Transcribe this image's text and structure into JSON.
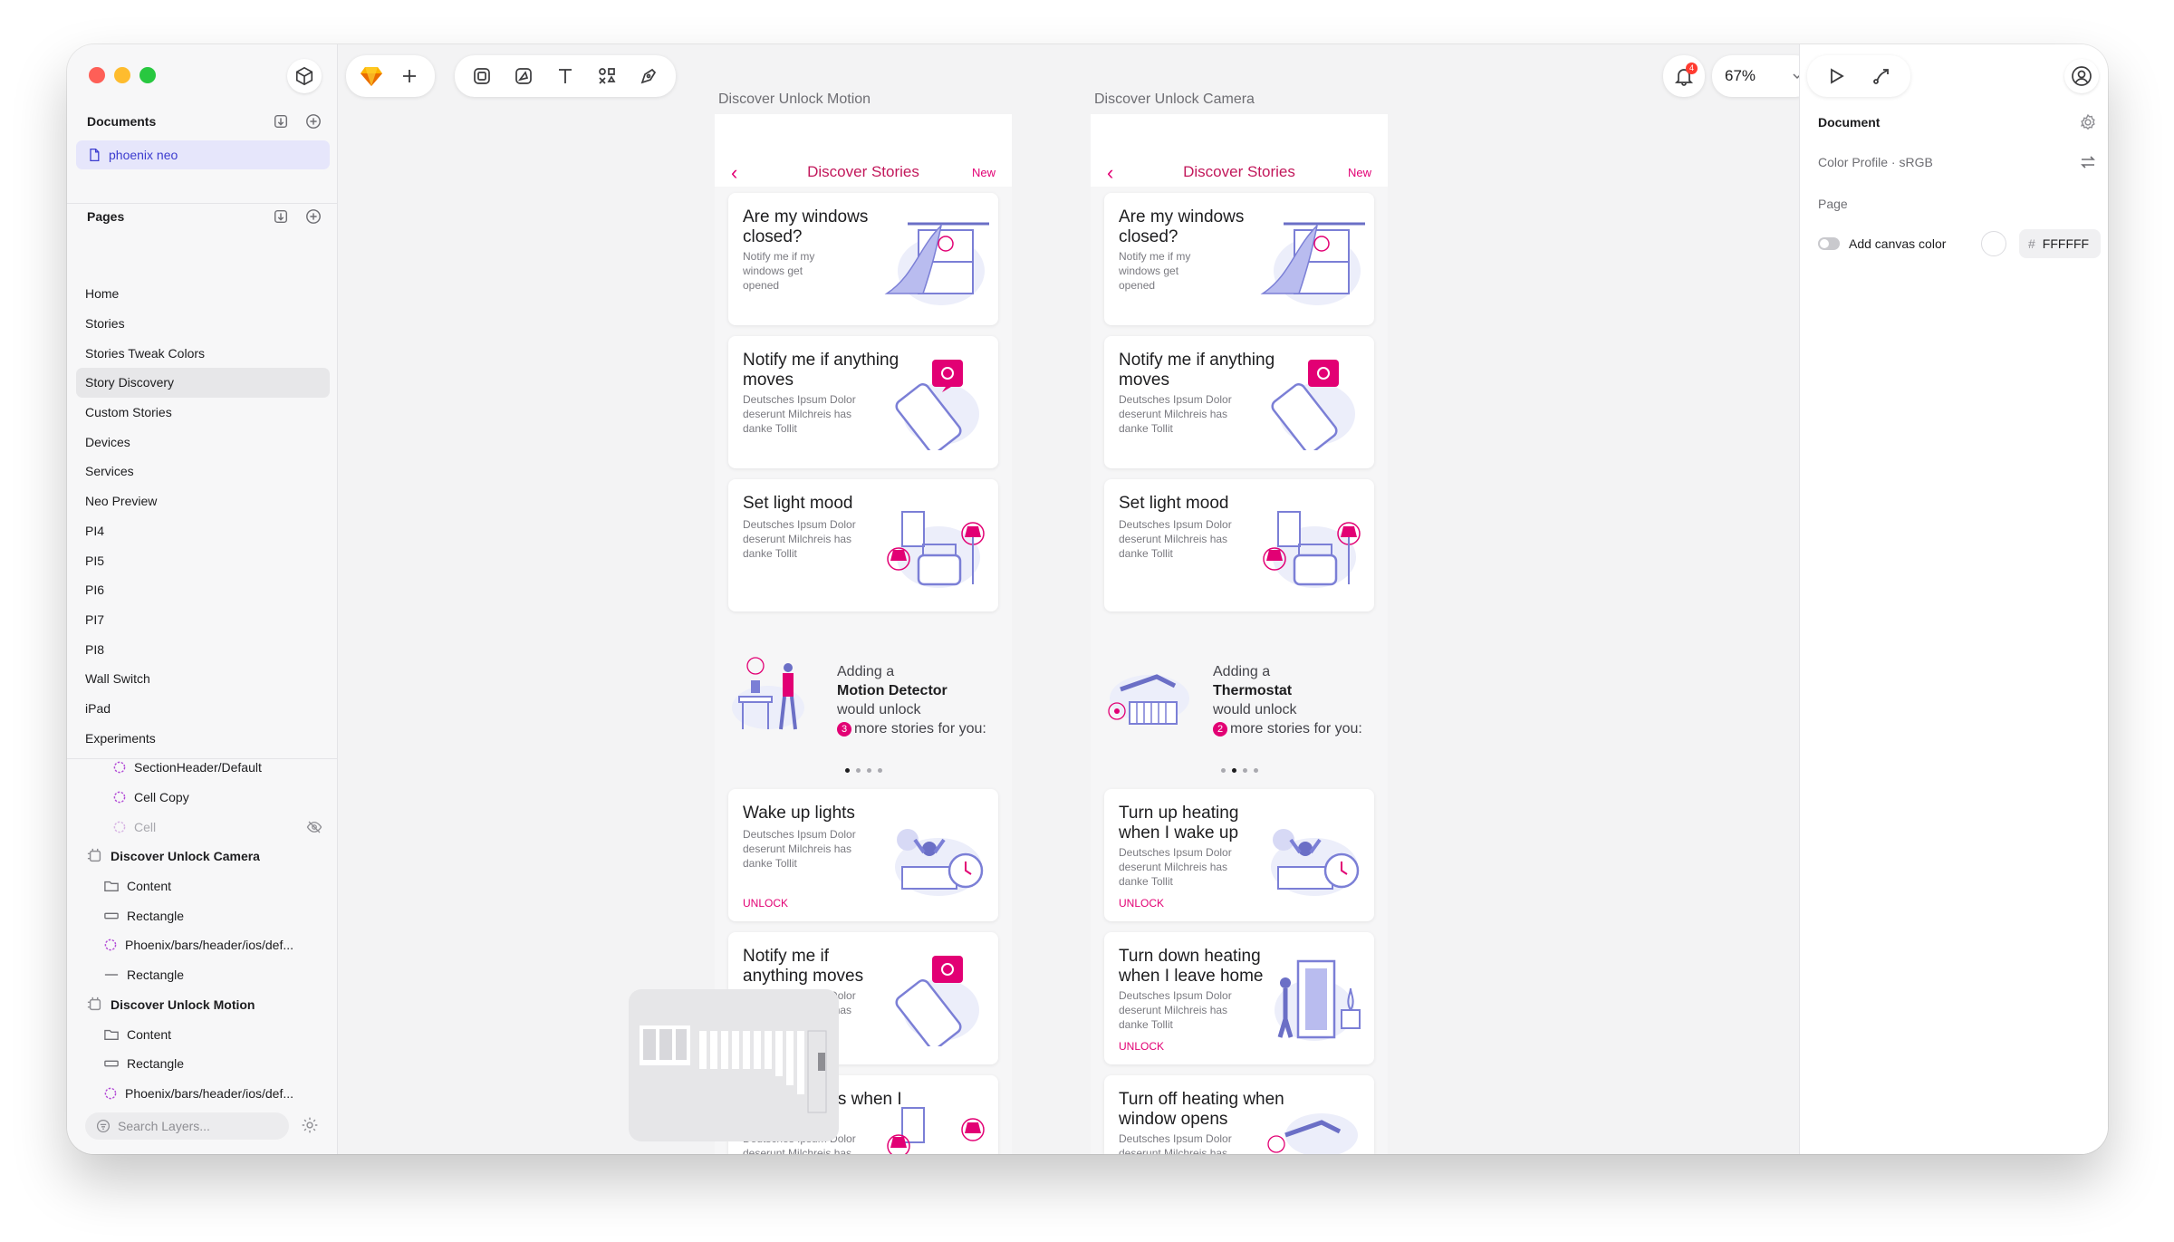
{
  "sidebar": {
    "documents_title": "Documents",
    "document_item": "phoenix neo",
    "pages_title": "Pages",
    "pages": [
      "Home",
      "Stories",
      "Stories Tweak Colors",
      "Story Discovery",
      "Custom Stories",
      "Devices",
      "Services",
      "Neo Preview",
      "PI4",
      "PI5",
      "PI6",
      "PI7",
      "PI8",
      "Wall Switch",
      "iPad",
      "Experiments"
    ],
    "active_page": "Story Discovery",
    "layers": {
      "section_header": "SectionHeader/Default",
      "cell_copy": "Cell Copy",
      "cell": "Cell",
      "artboard_camera": "Discover Unlock Camera",
      "artboard_motion": "Discover Unlock Motion",
      "content": "Content",
      "rectangle": "Rectangle",
      "phoenix_header": "Phoenix/bars/header/ios/def..."
    },
    "search_placeholder": "Search Layers..."
  },
  "toolbar": {
    "zoom": "67%",
    "notification_count": "4"
  },
  "canvas": {
    "frame_motion_label": "Discover Unlock Motion",
    "frame_camera_label": "Discover Unlock Camera",
    "header_title": "Discover Stories",
    "header_new": "New",
    "card_windows_title": "Are my windows closed?",
    "card_windows_body": "Notify me if my windows get opened",
    "card_moves_title": "Notify me if anything moves",
    "lorem": "Deutsches Ipsum Dolor deserunt Milchreis has danke Tollit",
    "card_light_title": "Set light mood",
    "adding_prefix": "Adding a",
    "adding_motion_device": "Motion Detector",
    "adding_camera_device": "Thermostat",
    "would_unlock": "would unlock",
    "motion_count": "3",
    "camera_count": "2",
    "more_stories": "more stories for you:",
    "unlock": "UNLOCK",
    "motion_wake_title": "Wake up lights",
    "motion_moves2_title": "Notify me if anything moves",
    "motion_come_home_title": "Turn on lights when I come home",
    "camera_heat_up_title": "Turn up heating when I wake up",
    "camera_heat_down_title": "Turn down heating when I leave home",
    "camera_heat_off_title": "Turn off heating when window opens"
  },
  "inspector": {
    "title": "Document",
    "color_profile": "Color Profile · sRGB",
    "page_label": "Page",
    "canvas_color_label": "Add canvas color",
    "hex_prefix": "#",
    "hex_value": "FFFFFF"
  },
  "colors": {
    "accent": "#e20074",
    "selection": "#e6e6fb",
    "illustration": "#7b7fd6"
  }
}
